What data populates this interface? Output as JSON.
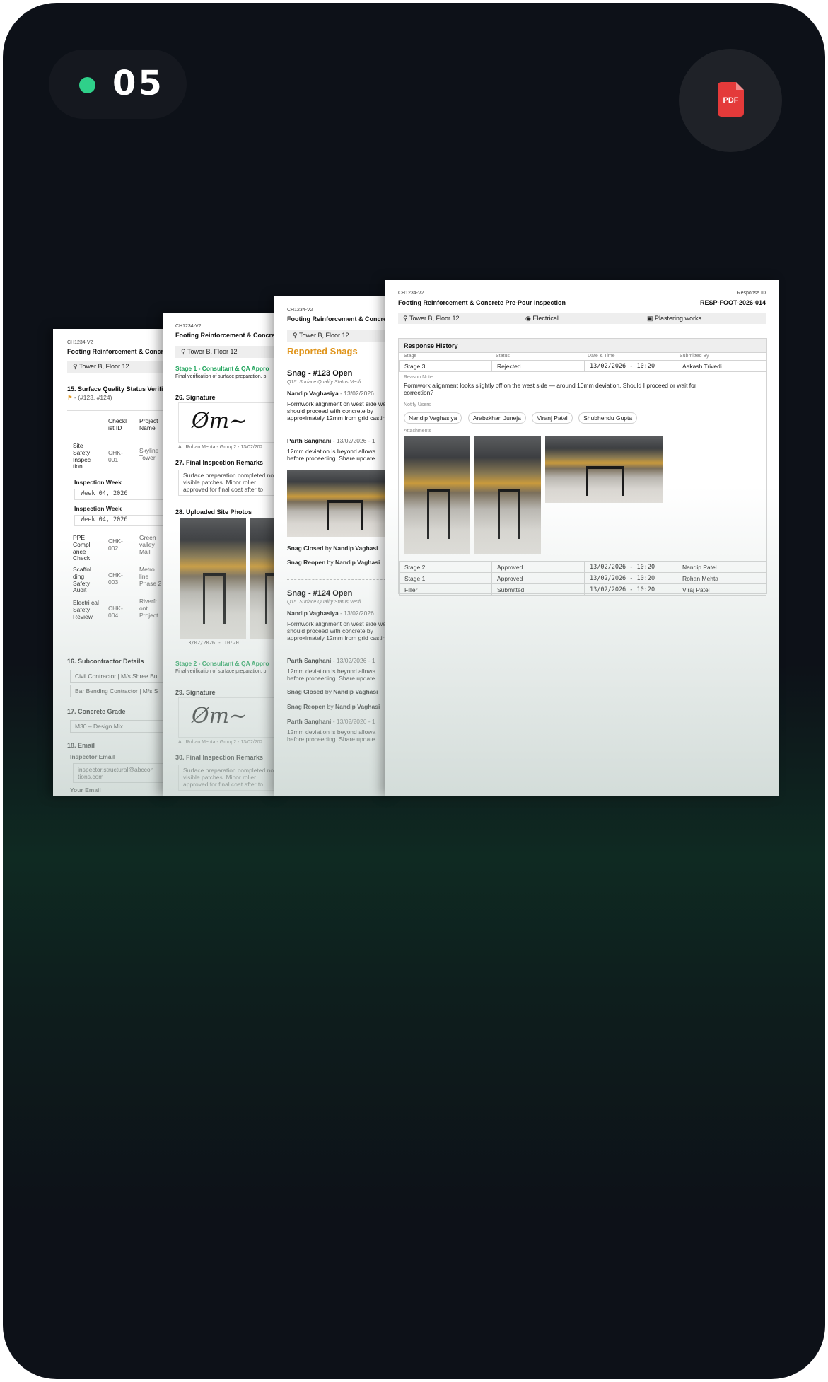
{
  "badge": {
    "number": "05"
  },
  "pdf_label": "PDF",
  "pages": {
    "p1": {
      "form_id": "CH1234-V2",
      "title": "Footing Reinforcement & Concrete",
      "location": "Tower B, Floor 12",
      "q15": "15. Surface Quality Status Verific",
      "q15_ref": "- (#123, #124)",
      "table_headers": [
        "Checkl ist ID",
        "Project Name"
      ],
      "rows": [
        {
          "name": "Site Safety Inspec tion",
          "id": "CHK- 001",
          "project": "Skyline Tower"
        },
        {
          "name": "PPE Compli ance Check",
          "id": "CHK- 002",
          "project": "Green valley Mall"
        },
        {
          "name": "Scaffol ding Safety Audit",
          "id": "CHK- 003",
          "project": "Metro line Phase 2"
        },
        {
          "name": "Electri cal Safety Review",
          "id": "CHK- 004",
          "project": "Riverfr ont Project"
        }
      ],
      "inspection_week_label": "Inspection Week",
      "inspection_week_value": "Week 04, 2026",
      "q16": "16. Subcontractor Details",
      "sub1": "Civil Contractor | M/s Shree Bu",
      "sub2": "Bar Bending Contractor | M/s S",
      "q17": "17. Concrete Grade",
      "grade": "M30 – Design Mix",
      "q18": "18. Email",
      "inspector_email_label": "Inspector Email",
      "inspector_email": "inspector.structural@abccon tions.com",
      "your_email_label": "Your Email"
    },
    "p2": {
      "form_id": "CH1234-V2",
      "title": "Footing Reinforcement & Concre",
      "location": "Tower B, Floor 12",
      "stage1": "Stage 1 - Consultant & QA Appro",
      "stage1_desc": "Final verification of surface preparation, p",
      "q26": "26. Signature",
      "sig_caption": "Ar. Rohan Mehta - Group2 - 13/02/202",
      "q27": "27. Final Inspection Remarks",
      "remarks": "Surface preparation completed no visible patches. Minor roller approved for final coat after to",
      "q28": "28. Uploaded Site Photos",
      "photo_ts": "13/02/2026 - 10:20",
      "stage2": "Stage 2 - Consultant & QA Appro",
      "stage2_desc": "Final verification of surface preparation, p",
      "q29": "29. Signature",
      "sig_caption2": "Ar. Rohan Mehta - Group2 - 13/02/202",
      "q30": "30. Final Inspection Remarks",
      "remarks2": "Surface preparation completed no visible patches. Minor roller approved for final coat after to"
    },
    "p3": {
      "form_id": "CH1234-V2",
      "title": "Footing Reinforcement & Concre",
      "location": "Tower B, Floor 12",
      "heading": "Reported Snags",
      "snag1_title": "Snag - #123 Open",
      "snag1_sub": "Q15. Surface Quality Status Verifi",
      "nandip": "Nandip Vaghasiya",
      "nandip_date": " - 13/02/2026",
      "nandip_text": "Formwork alignment on west side we should proceed with concrete by approximately 12mm from grid casting.",
      "parth": "Parth Sanghani",
      "parth_date": " - 13/02/2026 - 1",
      "parth_text": "12mm deviation is beyond allowa before proceeding. Share update",
      "closed": "Snag Closed",
      "reopen": "Snag Reopen",
      "by": " by ",
      "by_name": "Nandip Vaghasi",
      "snag2_title": "Snag - #124 Open",
      "snag2_sub": "Q15. Surface Quality Status Verifi"
    },
    "p4": {
      "form_id": "CH1234-V2",
      "response_id_label": "Response ID",
      "title": "Footing Reinforcement & Concrete Pre-Pour Inspection",
      "response_id": "RESP-FOOT-2026-014",
      "location": "Tower B, Floor 12",
      "discipline": "Electrical",
      "work": "Plastering works",
      "history_title": "Response History",
      "cols": [
        "Stage",
        "Status",
        "Date & Time",
        "Submitted By"
      ],
      "stage3": {
        "stage": "Stage 3",
        "status": "Rejected",
        "dt": "13/02/2026 - 10:20",
        "by": "Aakash Trivedi"
      },
      "reason_label": "Reason Note",
      "reason": "Formwork alignment looks slightly off on the west side — around 10mm deviation. Should I proceed or wait for correction?",
      "notify_label": "Notify Users",
      "notify": [
        "Nandip Vaghasiya",
        "Arabzkhan Juneja",
        "Viranj Patel",
        "Shubhendu Gupta"
      ],
      "attachments_label": "Attachments",
      "rows": [
        {
          "stage": "Stage 2",
          "status": "Approved",
          "dt": "13/02/2026 - 10:20",
          "by": "Nandip Patel"
        },
        {
          "stage": "Stage 1",
          "status": "Approved",
          "dt": "13/02/2026 - 10:20",
          "by": "Rohan Mehta"
        },
        {
          "stage": "Filler",
          "status": "Submitted",
          "dt": "13/02/2026 - 10:20",
          "by": "Viraj Patel"
        }
      ]
    }
  },
  "colors": {
    "accent_green": "#2fd08a",
    "pdf_red": "#e43a3a",
    "snag_orange": "#e0951c",
    "stage_green": "#1ea35a"
  }
}
